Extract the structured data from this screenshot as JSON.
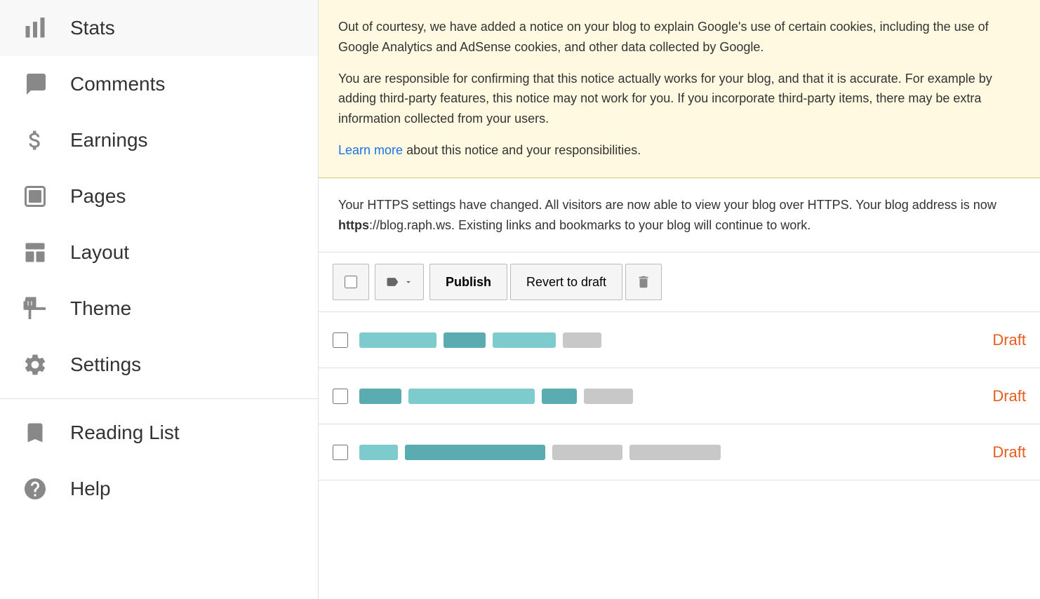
{
  "sidebar": {
    "items": [
      {
        "id": "stats",
        "label": "Stats",
        "icon": "stats-icon"
      },
      {
        "id": "comments",
        "label": "Comments",
        "icon": "comments-icon"
      },
      {
        "id": "earnings",
        "label": "Earnings",
        "icon": "earnings-icon"
      },
      {
        "id": "pages",
        "label": "Pages",
        "icon": "pages-icon"
      },
      {
        "id": "layout",
        "label": "Layout",
        "icon": "layout-icon"
      },
      {
        "id": "theme",
        "label": "Theme",
        "icon": "theme-icon"
      },
      {
        "id": "settings",
        "label": "Settings",
        "icon": "settings-icon"
      }
    ],
    "secondary_items": [
      {
        "id": "reading-list",
        "label": "Reading List",
        "icon": "reading-list-icon"
      },
      {
        "id": "help",
        "label": "Help",
        "icon": "help-icon"
      }
    ]
  },
  "notice": {
    "text1": "Out of courtesy, we have added a notice on your blog to explain Google's use of certain cookies, including the use of Google Analytics and AdSense cookies, and other data collected by Google.",
    "text2": "You are responsible for confirming that this notice actually works for your blog, and that it is accurate. For example by adding third-party features, this notice may not work for you. If you incorporate third-party items, there may be extra information collected from your users.",
    "learn_more": "Learn more",
    "learn_more_suffix": " about this notice and your responsibilities."
  },
  "https_notice": {
    "text": "Your HTTPS settings have changed. All visitors are now able to view your blog over HTTPS. Your blog address is now ",
    "url": "https://blog.raph.ws",
    "suffix": ". Existing links and bookmarks to your blog will continue to work."
  },
  "toolbar": {
    "publish_label": "Publish",
    "revert_label": "Revert to draft"
  },
  "posts": [
    {
      "id": "post-1",
      "status": "Draft"
    },
    {
      "id": "post-2",
      "status": "Draft"
    },
    {
      "id": "post-3",
      "status": "Draft"
    }
  ]
}
